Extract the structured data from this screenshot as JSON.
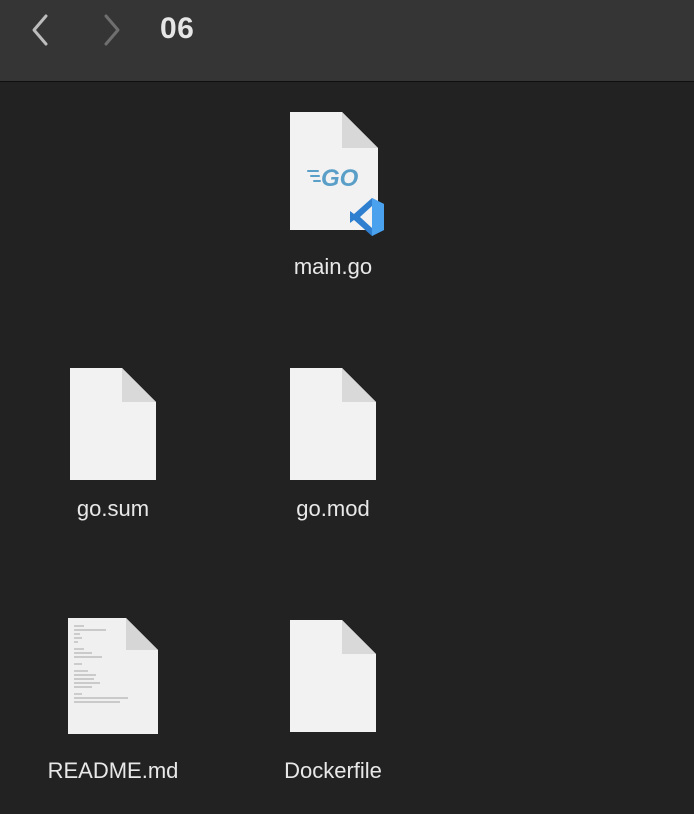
{
  "toolbar": {
    "title": "06",
    "back_icon": "chevron-left-icon",
    "forward_icon": "chevron-right-icon"
  },
  "files": [
    {
      "name": "main.go",
      "icon": "go-file-vscode-icon",
      "badge_text": "GO"
    },
    {
      "name": "go.sum",
      "icon": "blank-document-icon"
    },
    {
      "name": "go.mod",
      "icon": "blank-document-icon"
    },
    {
      "name": "README.md",
      "icon": "text-document-preview-icon"
    },
    {
      "name": "Dockerfile",
      "icon": "blank-document-icon"
    }
  ],
  "colors": {
    "background": "#222222",
    "toolbar": "#353535",
    "go_blue": "#5a9fc8",
    "vscode_blue": "#2f7fd0"
  }
}
